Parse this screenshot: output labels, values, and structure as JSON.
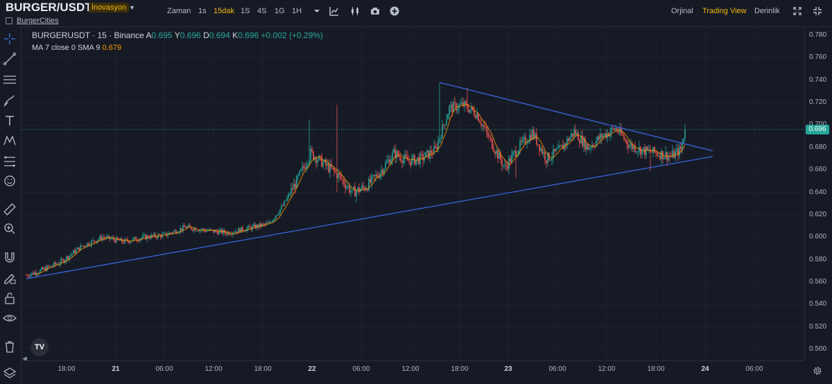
{
  "header": {
    "pair": "BURGER/USDT",
    "badge": "İnovasyon",
    "subtitle": "BurgerCities"
  },
  "toolbar": {
    "items": [
      {
        "label": "Zaman",
        "active": false
      },
      {
        "label": "1s",
        "active": false
      },
      {
        "label": "15dak",
        "active": true
      },
      {
        "label": "1S",
        "active": false
      },
      {
        "label": "4S",
        "active": false
      },
      {
        "label": "1G",
        "active": false
      },
      {
        "label": "1H",
        "active": false
      }
    ],
    "icons": [
      "chevron-down-icon",
      "indicator-icon",
      "candle-type-icon",
      "camera-icon",
      "plus-circle-icon"
    ]
  },
  "views": {
    "items": [
      {
        "label": "Orjinal",
        "active": false
      },
      {
        "label": "Trading View",
        "active": true
      },
      {
        "label": "Derinlik",
        "active": false
      }
    ],
    "icons": [
      "expand-icon",
      "fullscreen-icon"
    ]
  },
  "legend": {
    "symbol": "BURGERUSDT · 15 · Binance",
    "open_key": "A",
    "open": "0.695",
    "high_key": "Y",
    "high": "0.696",
    "low_key": "D",
    "low": "0.694",
    "close_key": "K",
    "close": "0.696",
    "change": "+0.002 (+0.29%)",
    "ma_label": "MA 7 close 0 SMA 9",
    "ma_value": "0.679"
  },
  "price_axis": {
    "ticks": [
      "0.780",
      "0.760",
      "0.740",
      "0.720",
      "0.700",
      "0.680",
      "0.660",
      "0.640",
      "0.620",
      "0.600",
      "0.580",
      "0.560",
      "0.540",
      "0.520",
      "0.500"
    ],
    "current": "0.696"
  },
  "time_axis": {
    "labels": [
      {
        "text": "18:00",
        "bold": false
      },
      {
        "text": "21",
        "bold": true
      },
      {
        "text": "06:00",
        "bold": false
      },
      {
        "text": "12:00",
        "bold": false
      },
      {
        "text": "18:00",
        "bold": false
      },
      {
        "text": "22",
        "bold": true
      },
      {
        "text": "06:00",
        "bold": false
      },
      {
        "text": "12:00",
        "bold": false
      },
      {
        "text": "18:00",
        "bold": false
      },
      {
        "text": "23",
        "bold": true
      },
      {
        "text": "06:00",
        "bold": false
      },
      {
        "text": "12:00",
        "bold": false
      },
      {
        "text": "18:00",
        "bold": false
      },
      {
        "text": "24",
        "bold": true
      },
      {
        "text": "06:00",
        "bold": false
      }
    ]
  },
  "tools": [
    "crosshair-icon",
    "trend-line-icon",
    "horizontal-lines-icon",
    "brush-icon",
    "text-icon",
    "pattern-icon",
    "fib-icon",
    "emoji-icon",
    "ruler-icon",
    "zoom-icon",
    "magnet-icon",
    "lock-pencil-icon",
    "lock-icon",
    "eye-icon",
    "trash-icon",
    "layers-icon"
  ],
  "colors": {
    "up": "#26a69a",
    "down": "#ef5350",
    "ma": "#ff9800",
    "trendline": "#3d6bf0",
    "accent": "#f0b90b"
  },
  "chart_data": {
    "type": "candlestick",
    "ylim": [
      0.49,
      0.79
    ],
    "keypoints": [
      {
        "t": 0,
        "p": 0.566
      },
      {
        "t": 10,
        "p": 0.57
      },
      {
        "t": 25,
        "p": 0.578
      },
      {
        "t": 40,
        "p": 0.592
      },
      {
        "t": 55,
        "p": 0.6
      },
      {
        "t": 70,
        "p": 0.596
      },
      {
        "t": 85,
        "p": 0.6
      },
      {
        "t": 100,
        "p": 0.602
      },
      {
        "t": 115,
        "p": 0.609
      },
      {
        "t": 130,
        "p": 0.606
      },
      {
        "t": 145,
        "p": 0.604
      },
      {
        "t": 160,
        "p": 0.608
      },
      {
        "t": 175,
        "p": 0.612
      },
      {
        "t": 185,
        "p": 0.628
      },
      {
        "t": 195,
        "p": 0.65
      },
      {
        "t": 205,
        "p": 0.675
      },
      {
        "t": 215,
        "p": 0.665
      },
      {
        "t": 225,
        "p": 0.655
      },
      {
        "t": 235,
        "p": 0.64
      },
      {
        "t": 245,
        "p": 0.645
      },
      {
        "t": 255,
        "p": 0.658
      },
      {
        "t": 265,
        "p": 0.675
      },
      {
        "t": 275,
        "p": 0.668
      },
      {
        "t": 285,
        "p": 0.67
      },
      {
        "t": 295,
        "p": 0.678
      },
      {
        "t": 305,
        "p": 0.715
      },
      {
        "t": 315,
        "p": 0.718
      },
      {
        "t": 325,
        "p": 0.71
      },
      {
        "t": 335,
        "p": 0.685
      },
      {
        "t": 345,
        "p": 0.662
      },
      {
        "t": 355,
        "p": 0.68
      },
      {
        "t": 365,
        "p": 0.693
      },
      {
        "t": 375,
        "p": 0.67
      },
      {
        "t": 385,
        "p": 0.678
      },
      {
        "t": 395,
        "p": 0.694
      },
      {
        "t": 405,
        "p": 0.68
      },
      {
        "t": 415,
        "p": 0.69
      },
      {
        "t": 425,
        "p": 0.697
      },
      {
        "t": 435,
        "p": 0.682
      },
      {
        "t": 445,
        "p": 0.677
      },
      {
        "t": 455,
        "p": 0.675
      },
      {
        "t": 465,
        "p": 0.672
      },
      {
        "t": 472,
        "p": 0.678
      },
      {
        "t": 475,
        "p": 0.696
      }
    ],
    "candle_count": 476,
    "ma_period": 7,
    "trendlines": [
      {
        "from": {
          "t": 0,
          "p": 0.563
        },
        "to": {
          "t": 495,
          "p": 0.672
        }
      },
      {
        "from": {
          "t": 298,
          "p": 0.738
        },
        "to": {
          "t": 495,
          "p": 0.677
        }
      }
    ],
    "current_price": 0.696
  }
}
